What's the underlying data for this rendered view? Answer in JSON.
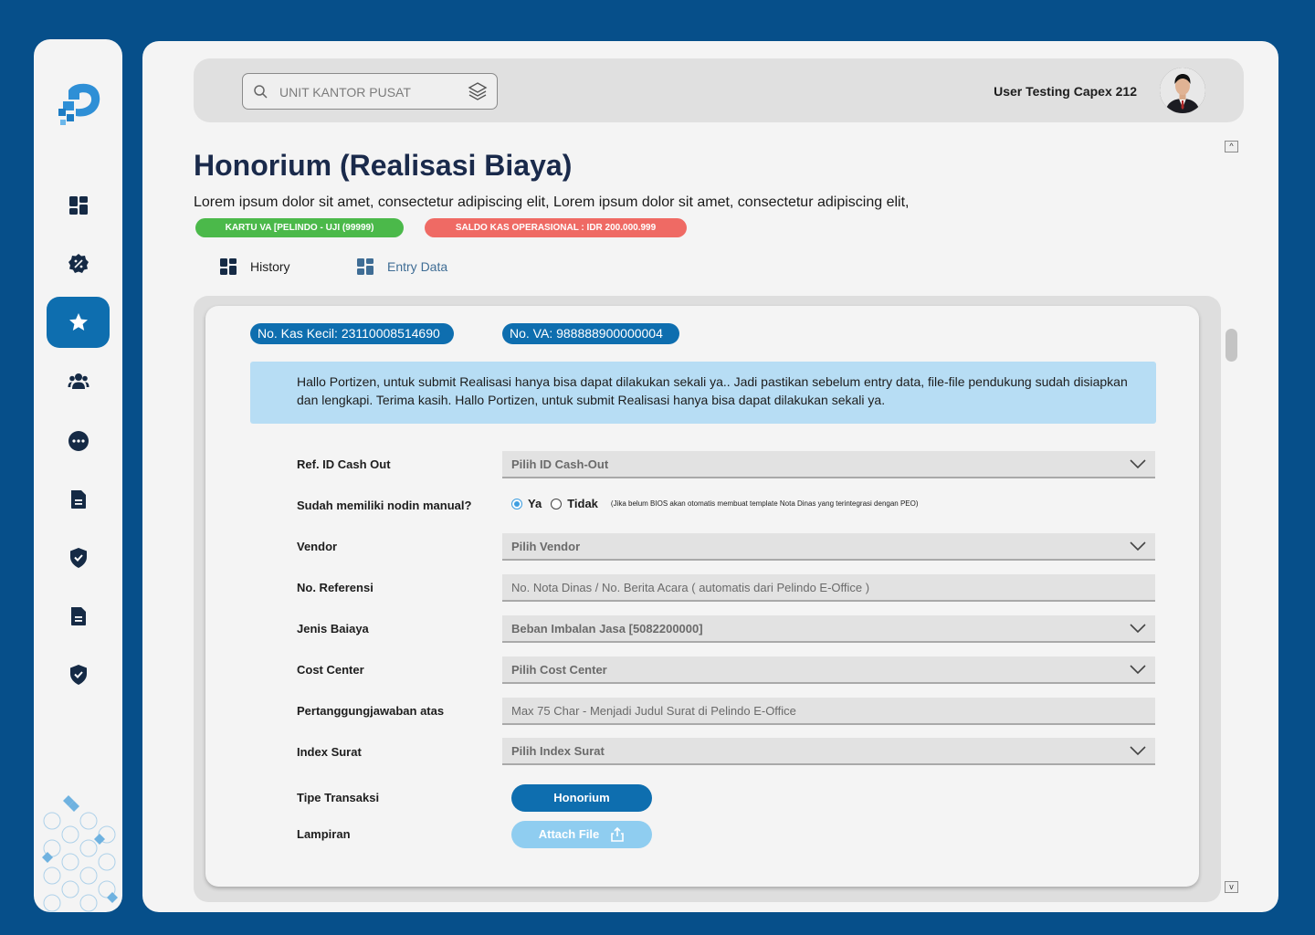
{
  "sidebar": {
    "items": [
      {
        "icon": "dashboard-icon",
        "active": false
      },
      {
        "icon": "discount-badge-icon",
        "active": false
      },
      {
        "icon": "star-icon",
        "active": true
      },
      {
        "icon": "users-icon",
        "active": false
      },
      {
        "icon": "more-icon",
        "active": false
      },
      {
        "icon": "document-icon",
        "active": false
      },
      {
        "icon": "shield-check-icon",
        "active": false
      },
      {
        "icon": "document-icon",
        "active": false
      },
      {
        "icon": "shield-check-icon",
        "active": false
      }
    ]
  },
  "header": {
    "search_placeholder": "UNIT KANTOR PUSAT",
    "username": "User Testing Capex 212"
  },
  "page": {
    "title": "Honorium (Realisasi Biaya)",
    "description": "Lorem ipsum dolor sit amet, consectetur adipiscing elit, Lorem ipsum dolor sit amet, consectetur adipiscing elit,",
    "badge_card": "KARTU VA [PELINDO - UJI (99999)",
    "badge_balance": "SALDO KAS OPERASIONAL : IDR 200.000.999"
  },
  "tabs": [
    {
      "label": "History"
    },
    {
      "label": "Entry Data"
    }
  ],
  "form": {
    "kas_kecil": "No. Kas Kecil: 23110008514690",
    "no_va": "No. VA: 988888900000004",
    "info": "Hallo Portizen, untuk submit Realisasi hanya bisa dapat dilakukan sekali ya..  Jadi pastikan sebelum entry data, file-file pendukung sudah disiapkan dan lengkapi. Terima kasih. Hallo Portizen, untuk submit Realisasi hanya bisa dapat dilakukan sekali ya.",
    "labels": {
      "ref_id": "Ref. ID Cash Out",
      "nodin": "Sudah memiliki nodin manual?",
      "vendor": "Vendor",
      "no_ref": "No. Referensi",
      "jenis": "Jenis Baiaya",
      "cost_center": "Cost Center",
      "pertanggung": "Pertanggungjawaban atas",
      "index": "Index Surat",
      "tipe": "Tipe Transaksi",
      "lampiran": "Lampiran"
    },
    "values": {
      "ref_id": "Pilih ID Cash-Out",
      "vendor": "Pilih Vendor",
      "no_ref": "No. Nota Dinas / No. Berita Acara ( automatis dari Pelindo E-Office )",
      "jenis": "Beban Imbalan Jasa [5082200000]",
      "cost_center": "Pilih Cost Center",
      "pertanggung": "Max 75 Char - Menjadi Judul Surat di Pelindo E-Office",
      "index": "Pilih Index Surat"
    },
    "radio": {
      "yes": "Ya",
      "no": "Tidak",
      "note": "(Jika belum BIOS akan otomatis membuat template Nota Dinas yang terintegrasi dengan PEO)",
      "selected": "Ya"
    },
    "buttons": {
      "honorium": "Honorium",
      "attach": "Attach File"
    }
  },
  "colors": {
    "background": "#064f8a",
    "primary": "#0e6eaf",
    "green_badge": "#4bb94a",
    "red_badge": "#ef6a64",
    "info_bg": "#b7ddf4"
  }
}
